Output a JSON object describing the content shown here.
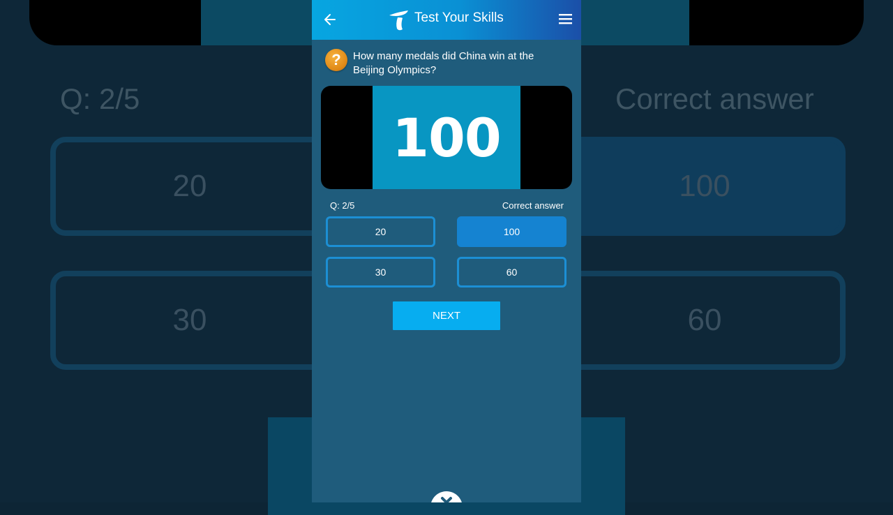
{
  "app": {
    "title": "Test Your Skills"
  },
  "question": {
    "text": "How many medals did China win at the Beijing Olympics?",
    "media_number": "100",
    "counter": "Q: 2/5",
    "status": "Correct answer"
  },
  "options": [
    {
      "label": "20",
      "correct": false
    },
    {
      "label": "100",
      "correct": true
    },
    {
      "label": "30",
      "correct": false
    },
    {
      "label": "60",
      "correct": false
    }
  ],
  "next_label": "NEXT",
  "colors": {
    "header_start": "#07a6e1",
    "header_end": "#1b4fa8",
    "screen_bg": "#1f5c7c",
    "option_border": "#1c8fd4",
    "correct_fill": "#1583d1",
    "next_button": "#07adf0",
    "question_badge": "#e08a18"
  },
  "icons": [
    "back-arrow-icon",
    "telenor-logo-icon",
    "hamburger-menu-icon",
    "question-mark-icon",
    "close-icon"
  ]
}
